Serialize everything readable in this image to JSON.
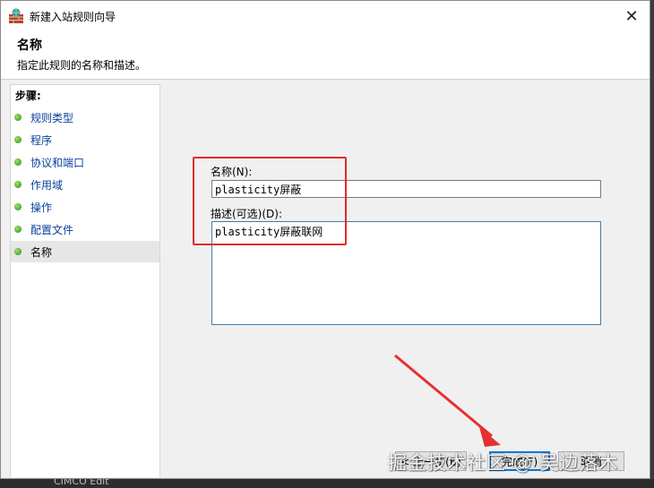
{
  "window": {
    "title": "新建入站规则向导",
    "close_glyph": "✕"
  },
  "header": {
    "title": "名称",
    "description": "指定此规则的名称和描述。"
  },
  "steps": {
    "label": "步骤:",
    "items": [
      {
        "label": "规则类型"
      },
      {
        "label": "程序"
      },
      {
        "label": "协议和端口"
      },
      {
        "label": "作用域"
      },
      {
        "label": "操作"
      },
      {
        "label": "配置文件"
      },
      {
        "label": "名称",
        "active": true
      }
    ]
  },
  "form": {
    "name_label": "名称(N):",
    "name_value": "plasticity屏蔽",
    "desc_label": "描述(可选)(D):",
    "desc_value": "plasticity屏蔽联网"
  },
  "buttons": {
    "back_label": "< 上一步(B)",
    "finish_label": "完成(F)",
    "cancel_label": "取消"
  },
  "watermark": "掘金技术社区 @ 吴边落木",
  "background_text": "CIMCO Edit",
  "colors": {
    "annotation": "#e02b2b",
    "step_dot": "#2f8a1f",
    "step_link": "#0a3f9c"
  },
  "icons": {
    "app": "firewall-icon",
    "close": "close-icon",
    "step": "green-dot-icon"
  }
}
